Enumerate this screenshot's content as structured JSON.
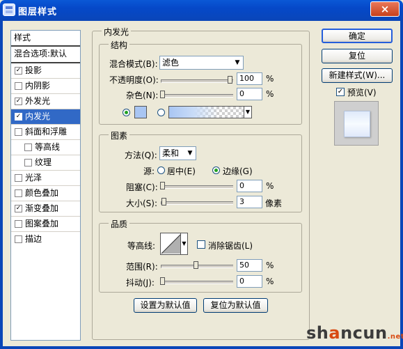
{
  "window": {
    "title": "图层样式",
    "close_glyph": "×"
  },
  "left_list": {
    "header": "样式",
    "blend_default": "混合选项:默认",
    "items": [
      {
        "label": "投影",
        "checked": "✓"
      },
      {
        "label": "内阴影",
        "checked": ""
      },
      {
        "label": "外发光",
        "checked": "✓"
      },
      {
        "label": "内发光",
        "checked": "✓"
      },
      {
        "label": "斜面和浮雕",
        "checked": ""
      },
      {
        "label": "等高线",
        "checked": ""
      },
      {
        "label": "纹理",
        "checked": ""
      },
      {
        "label": "光泽",
        "checked": ""
      },
      {
        "label": "颜色叠加",
        "checked": ""
      },
      {
        "label": "渐变叠加",
        "checked": "✓"
      },
      {
        "label": "图案叠加",
        "checked": ""
      },
      {
        "label": "描边",
        "checked": ""
      }
    ]
  },
  "buttons": {
    "ok": "确定",
    "reset": "复位",
    "new_style": "新建样式(W)...",
    "preview": "预览(V)",
    "preview_checked": "✓"
  },
  "inner_glow": {
    "title": "内发光",
    "structure": {
      "title": "结构",
      "blend_mode_label": "混合模式(B):",
      "blend_mode_value": "滤色",
      "opacity_label": "不透明度(O):",
      "opacity_value": "100",
      "noise_label": "杂色(N):",
      "noise_value": "0",
      "unit": "%",
      "glow_color": "#a9c6f3"
    },
    "elements": {
      "title": "图素",
      "method_label": "方法(Q):",
      "method_value": "柔和",
      "source_label": "源:",
      "source_center": "居中(E)",
      "source_edge": "边缘(G)",
      "choke_label": "阻塞(C):",
      "choke_value": "0",
      "size_label": "大小(S):",
      "size_value": "3",
      "size_unit": "像素",
      "unit": "%"
    },
    "quality": {
      "title": "品质",
      "contour_label": "等高线:",
      "antialias_label": "消除锯齿(L)",
      "range_label": "范围(R):",
      "range_value": "50",
      "jitter_label": "抖动(J):",
      "jitter_value": "0",
      "unit": "%"
    },
    "set_default": "设置为默认值",
    "reset_default": "复位为默认值"
  },
  "watermark": {
    "part1": "sh",
    "part2": "a",
    "part3": "ncun",
    "part4": ".net"
  }
}
